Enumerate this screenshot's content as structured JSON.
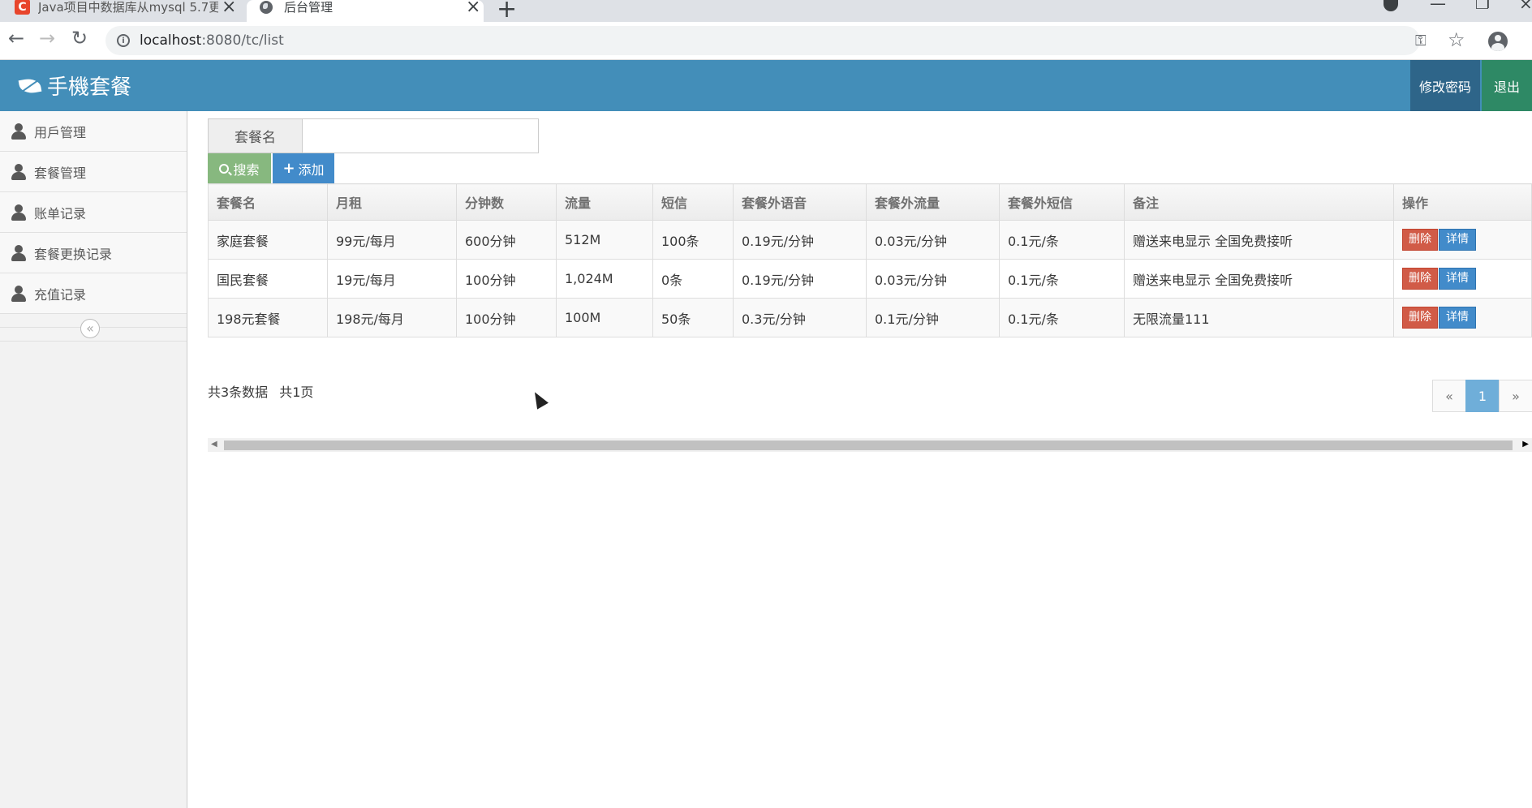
{
  "browser": {
    "tabs": [
      {
        "title": "Java项目中数据库从mysql 5.7更"
      },
      {
        "title": "后台管理"
      }
    ],
    "url_host": "localhost",
    "url_rest": ":8080/tc/list"
  },
  "header": {
    "brand": "手機套餐",
    "change_password": "修改密码",
    "logout": "退出"
  },
  "sidebar": {
    "items": [
      {
        "label": "用戶管理"
      },
      {
        "label": "套餐管理"
      },
      {
        "label": "账单记录"
      },
      {
        "label": "套餐更换记录"
      },
      {
        "label": "充值记录"
      }
    ]
  },
  "search": {
    "label": "套餐名",
    "value": "",
    "placeholder": "",
    "search_button": "搜索",
    "add_button": "添加"
  },
  "table": {
    "headers": [
      "套餐名",
      "月租",
      "分钟数",
      "流量",
      "短信",
      "套餐外语音",
      "套餐外流量",
      "套餐外短信",
      "备注",
      "操作"
    ],
    "rows": [
      [
        "家庭套餐",
        "99元/每月",
        "600分钟",
        "512M",
        "100条",
        "0.19元/分钟",
        "0.03元/分钟",
        "0.1元/条",
        "赠送来电显示 全国免费接听"
      ],
      [
        "国民套餐",
        "19元/每月",
        "100分钟",
        "1,024M",
        "0条",
        "0.19元/分钟",
        "0.03元/分钟",
        "0.1元/条",
        "赠送来电显示 全国免费接听"
      ],
      [
        "198元套餐",
        "198元/每月",
        "100分钟",
        "100M",
        "50条",
        "0.3元/分钟",
        "0.1元/分钟",
        "0.1元/条",
        "无限流量111"
      ]
    ],
    "delete_label": "删除",
    "detail_label": "详情"
  },
  "pagination": {
    "total_records": "共3条数据",
    "total_pages": "共1页",
    "prev": "«",
    "current": "1",
    "next": "»"
  },
  "colors": {
    "header_bg": "#438eb9",
    "change_password_bg": "#2e6589",
    "logout_bg": "#2e8965",
    "search_btn": "#87b87f",
    "add_btn": "#428bca",
    "delete_btn": "#d15b47",
    "detail_btn": "#428bca",
    "active_page": "#6faed9"
  }
}
